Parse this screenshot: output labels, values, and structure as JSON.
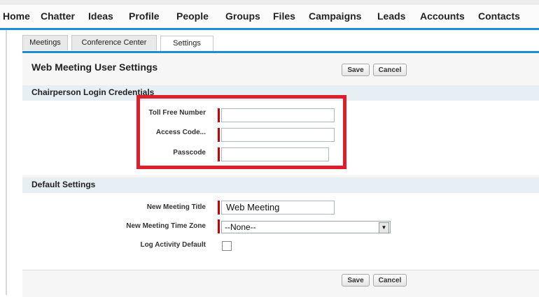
{
  "nav": {
    "items": [
      "Home",
      "Chatter",
      "Ideas",
      "Profile",
      "People",
      "Groups",
      "Files",
      "Campaigns",
      "Leads",
      "Accounts",
      "Contacts"
    ]
  },
  "tabs": [
    "Meetings",
    "Conference Center",
    "Settings"
  ],
  "header": {
    "title": "Web Meeting User Settings",
    "save_label": "Save",
    "cancel_label": "Cancel"
  },
  "sections": {
    "chairperson": {
      "title": "Chairperson Login Credentials",
      "toll_free_label": "Toll Free Number",
      "toll_free_value": "",
      "access_code_label": "Access Code...",
      "access_code_value": "",
      "passcode_label": "Passcode",
      "passcode_value": ""
    },
    "defaults": {
      "title": "Default Settings",
      "meeting_title_label": "New Meeting Title",
      "meeting_title_value": "Web Meeting",
      "time_zone_label": "New Meeting Time Zone",
      "time_zone_value": "--None--",
      "log_activity_label": "Log Activity Default",
      "log_activity_checked": false
    }
  },
  "footer": {
    "save_label": "Save",
    "cancel_label": "Cancel"
  },
  "colors": {
    "accent": "#1f8dd6",
    "required": "#cc0000",
    "highlight": "#e21d2b"
  }
}
